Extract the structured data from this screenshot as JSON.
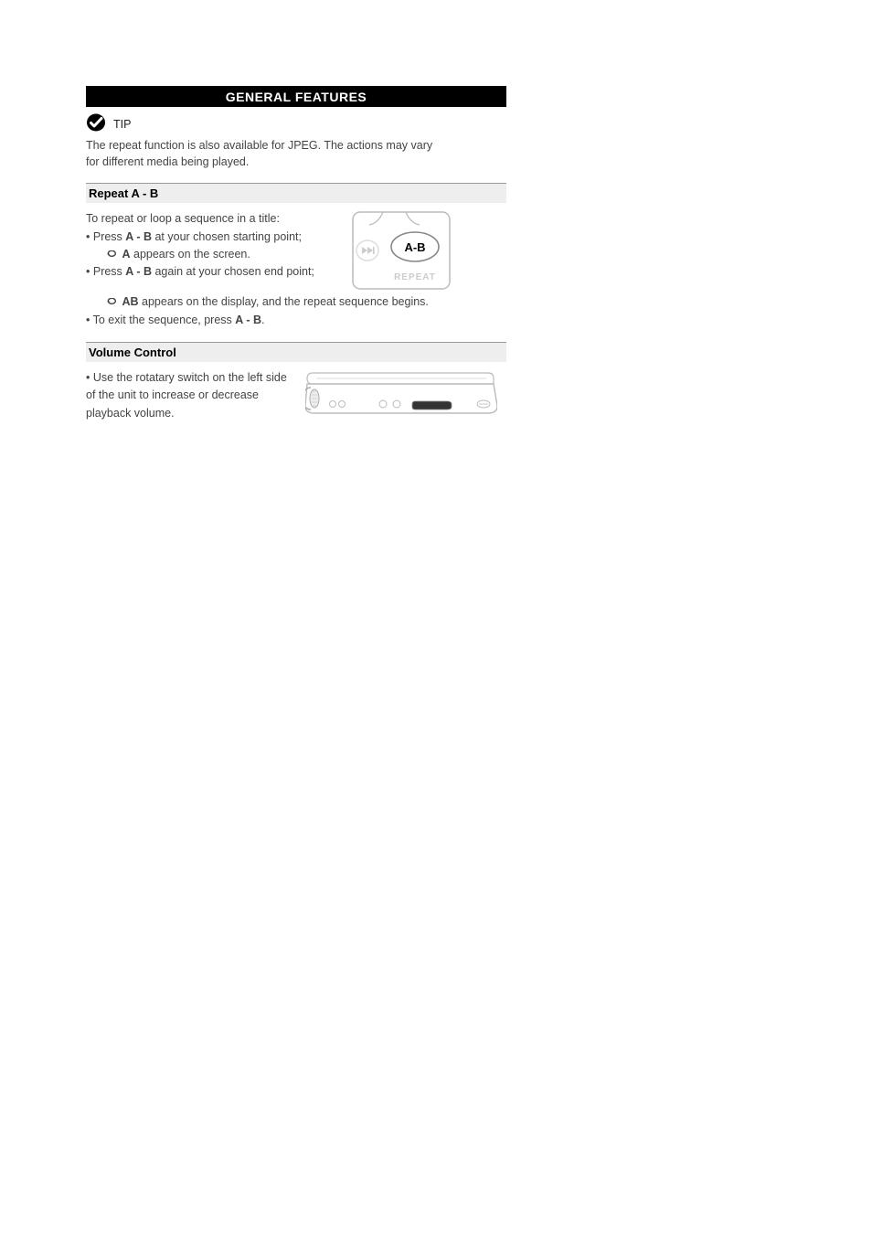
{
  "banner": "GENERAL FEATURES",
  "tip": {
    "label": "TIP",
    "text": "The repeat function is also available for JPEG. The actions may vary for different media being played."
  },
  "repeatAB": {
    "heading": "Repeat A - B",
    "intro": "To repeat or loop a sequence in a title:",
    "bullet1_pre": "Press ",
    "bullet1_bold": "A - B",
    "bullet1_post": " at your chosen starting point;",
    "sub1_bold": "A",
    "sub1_post": " appears on the screen.",
    "bullet2_pre": "Press ",
    "bullet2_bold": "A - B",
    "bullet2_post": " again at your chosen end point;",
    "sub2_bold": "AB",
    "sub2_post": " appears on the display, and the repeat sequence begins.",
    "bullet3_pre": "To exit the sequence, press ",
    "bullet3_bold": "A - B",
    "bullet3_post": "."
  },
  "remote": {
    "button_label": "A-B",
    "caption": "REPEAT"
  },
  "volume": {
    "heading": "Volume Control",
    "text": "Use the rotatary switch on the left side of the unit to increase or decrease playback volume."
  }
}
